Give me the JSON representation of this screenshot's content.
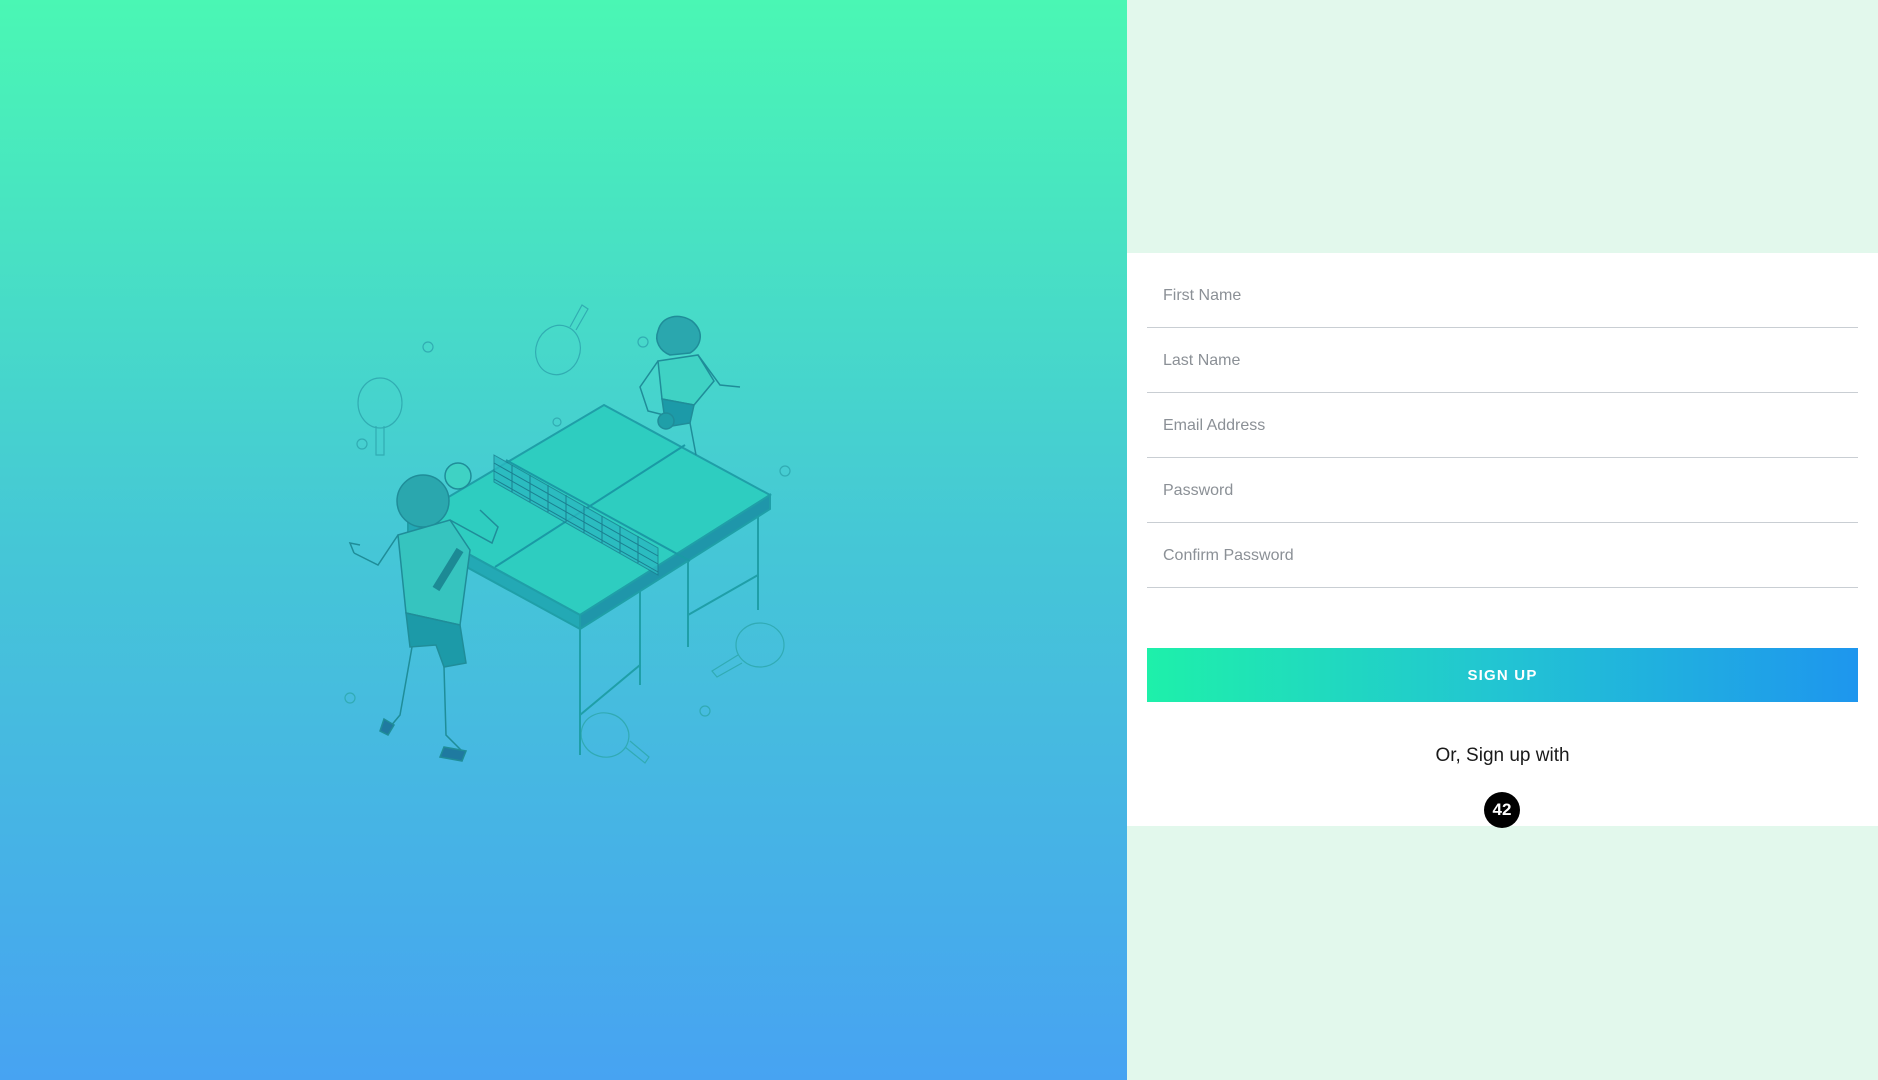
{
  "colors": {
    "left_gradient_top": "#4af7b4",
    "left_gradient_bottom": "#47a3f2",
    "right_background": "#e2f8ec",
    "button_gradient_start": "#1ef0aa",
    "button_gradient_end": "#1e96ee"
  },
  "illustration": {
    "icon": "ping-pong-players-illustration"
  },
  "form": {
    "fields": [
      {
        "placeholder": "First Name",
        "value": ""
      },
      {
        "placeholder": "Last Name",
        "value": ""
      },
      {
        "placeholder": "Email Address",
        "value": ""
      },
      {
        "placeholder": "Password",
        "value": ""
      },
      {
        "placeholder": "Confirm Password",
        "value": ""
      }
    ],
    "submit_label": "SIGN UP",
    "alt_text": "Or, Sign up with",
    "provider_label": "42"
  }
}
